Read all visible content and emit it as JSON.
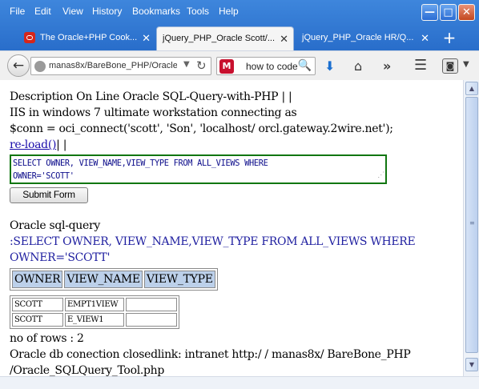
{
  "menu": {
    "file": "File",
    "edit": "Edit",
    "view": "View",
    "history": "History",
    "bookmarks": "Bookmarks",
    "tools": "Tools",
    "help": "Help"
  },
  "window_controls": {
    "minimize": "—",
    "maximize": "□",
    "close": "✕"
  },
  "tabs": [
    {
      "label": "The Oracle+PHP Cook..."
    },
    {
      "label": "jQuery_PHP_Oracle Scott/..."
    },
    {
      "label": "jQuery_PHP_Oracle HR/Q..."
    }
  ],
  "navbar": {
    "url": "manas8x/BareBone_PHP/Oracle_",
    "search_value": "how to code"
  },
  "page": {
    "line1": "Description On Line Oracle SQL-Query-with-PHP | |",
    "line2": "IIS in windows 7 ultimate workstation connecting as",
    "line3": "$conn = oci_connect('scott', 'Son', 'localhost/ orcl.gateway.2wire.net');",
    "reload_link": "re-load()",
    "reload_suffix": "| |",
    "sql_input_line1": "SELECT OWNER, VIEW_NAME,VIEW_TYPE FROM ALL_VIEWS WHERE",
    "sql_input_line2": "OWNER='SCOTT'",
    "submit_label": "Submit Form",
    "query_heading": "Oracle sql-query",
    "query_echo_line1": ":SELECT OWNER, VIEW_NAME,VIEW_TYPE FROM ALL_VIEWS WHERE",
    "query_echo_line2": "OWNER='SCOTT'",
    "columns": [
      "OWNER",
      "VIEW_NAME",
      "VIEW_TYPE"
    ],
    "rows": [
      [
        "SCOTT",
        "EMPT1VIEW",
        ""
      ],
      [
        "SCOTT",
        "E_VIEW1",
        ""
      ]
    ],
    "row_count": "no of rows : 2",
    "footer_line1": "Oracle db conection closedlink: intranet http:/ / manas8x/ BareBone_PHP",
    "footer_line2": "/Oracle_SQLQuery_Tool.php"
  }
}
